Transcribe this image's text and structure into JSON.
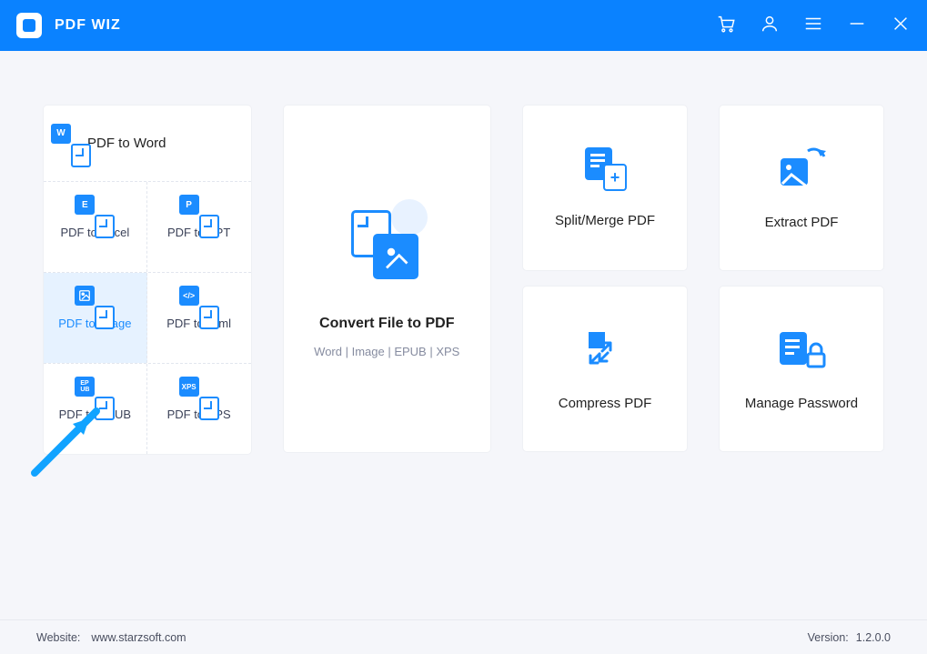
{
  "app": {
    "title": "PDF WIZ"
  },
  "left": {
    "top": "PDF to Word",
    "cells": [
      {
        "label": "PDF to Excel",
        "letter": "E"
      },
      {
        "label": "PDF to PPT",
        "letter": "P"
      },
      {
        "label": "PDF to Image",
        "letter": "IMG",
        "highlight": true
      },
      {
        "label": "PDF to Html",
        "letter": "</>"
      },
      {
        "label": "PDF to EPUB",
        "letter": "EP\nUB"
      },
      {
        "label": "PDF to XPS",
        "letter": "XPS"
      }
    ]
  },
  "mid": {
    "title": "Convert File to PDF",
    "sub": "Word | Image | EPUB | XPS"
  },
  "right1": [
    {
      "label": "Split/Merge PDF"
    },
    {
      "label": "Compress PDF"
    }
  ],
  "right2": [
    {
      "label": "Extract PDF"
    },
    {
      "label": "Manage Password"
    }
  ],
  "footer": {
    "website_label": "Website:",
    "website": "www.starzsoft.com",
    "version_label": "Version:",
    "version": "1.2.0.0"
  }
}
